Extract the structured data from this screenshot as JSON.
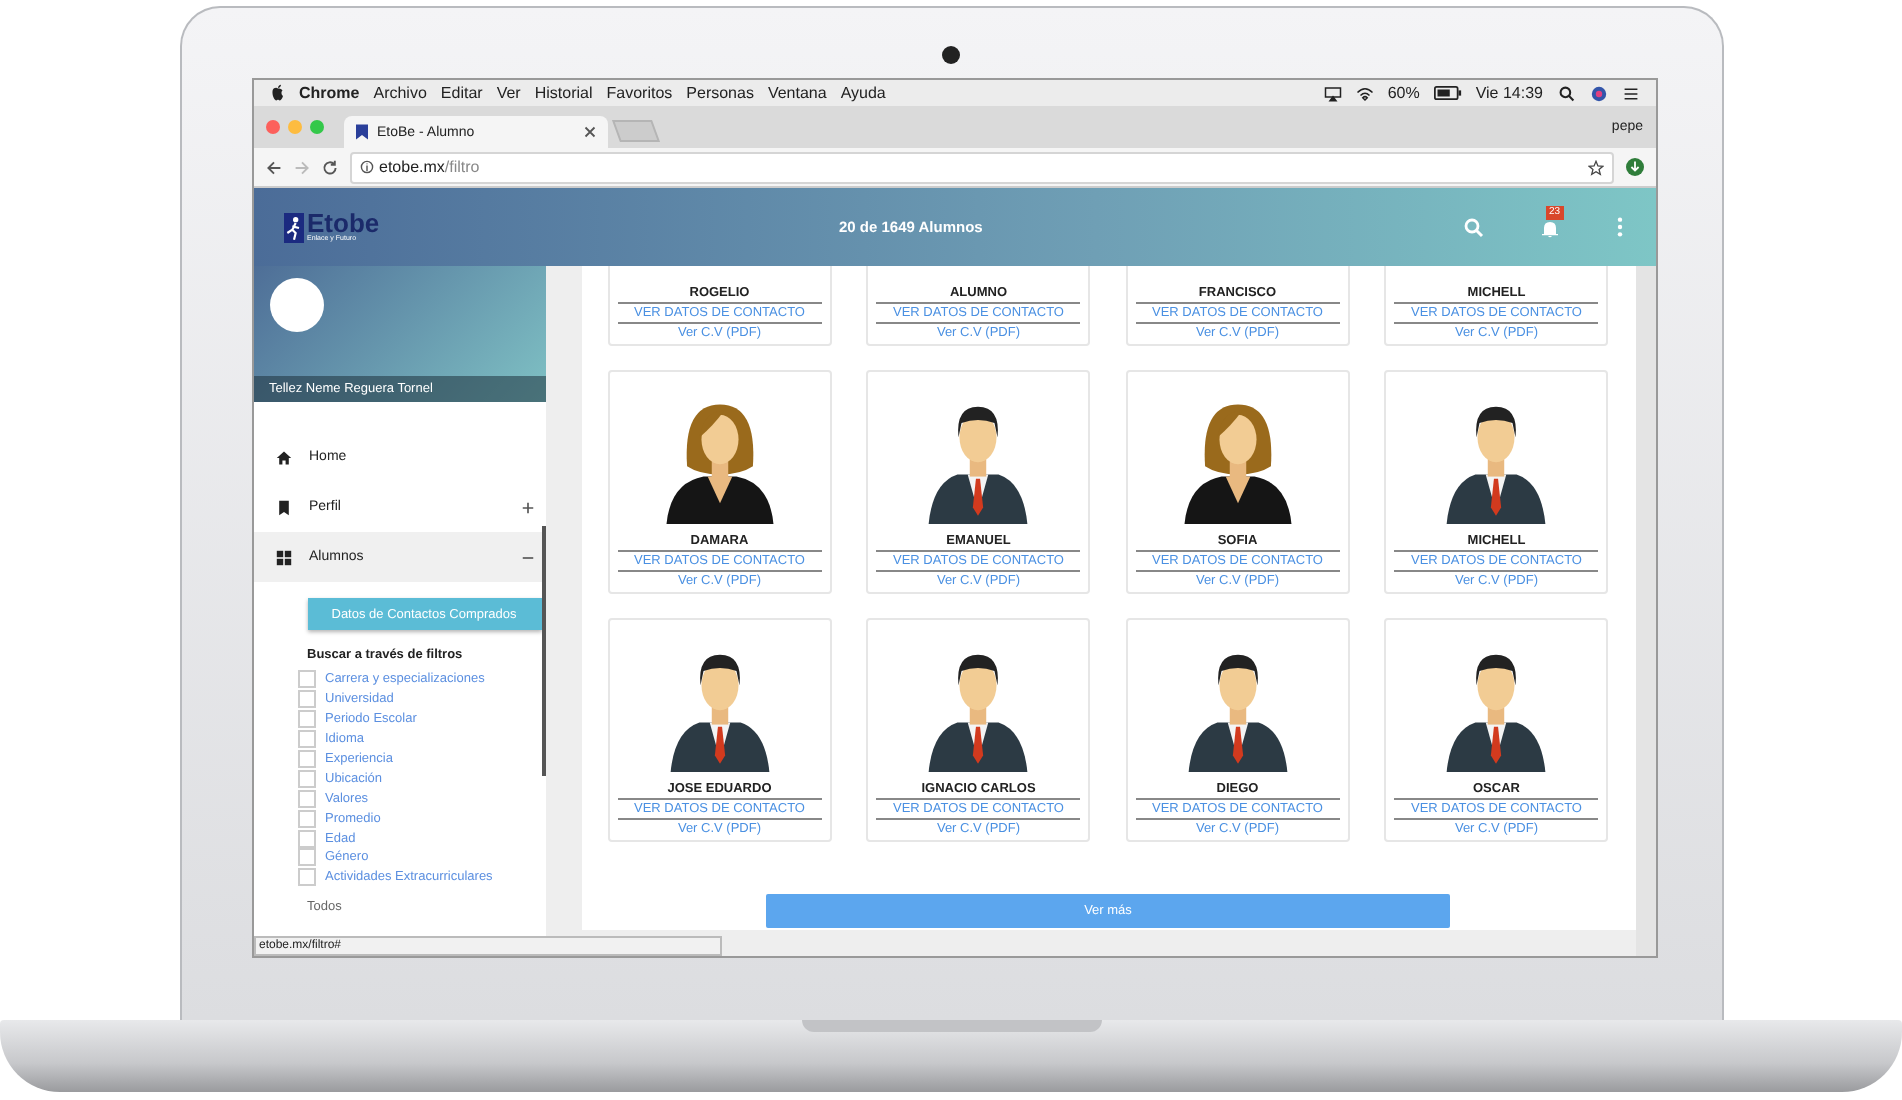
{
  "menu_bar": {
    "app": "Chrome",
    "items": [
      "Archivo",
      "Editar",
      "Ver",
      "Historial",
      "Favoritos",
      "Personas",
      "Ventana",
      "Ayuda"
    ],
    "battery": "60%",
    "clock": "Vie 14:39"
  },
  "browser": {
    "tab_title": "EtoBe - Alumno",
    "profile": "pepe",
    "url_host": "etobe.mx",
    "url_path": "/filtro",
    "status_url": "etobe.mx/filtro#"
  },
  "header": {
    "logo": "Etobe",
    "tagline": "Enlace y Futuro",
    "title": "20 de 1649 Alumnos",
    "notifications": "23"
  },
  "sidebar": {
    "user_name": "Tellez Neme Reguera Tornel",
    "items": [
      {
        "label": "Home",
        "kind": "home",
        "selected": false
      },
      {
        "label": "Perfil",
        "kind": "bookmark",
        "selected": false,
        "expanded": false
      },
      {
        "label": "Alumnos",
        "kind": "grid",
        "selected": true,
        "expanded": true
      }
    ],
    "purchased_button": "Datos de Contactos Comprados",
    "filters_heading": "Buscar a través de filtros",
    "filters": [
      {
        "label": "Carrera y especializaciones",
        "checked": false
      },
      {
        "label": "Universidad",
        "checked": false
      },
      {
        "label": "Periodo Escolar",
        "checked": false
      },
      {
        "label": "Idioma",
        "checked": false
      },
      {
        "label": "Experiencia",
        "checked": false
      },
      {
        "label": "Ubicación",
        "checked": false
      },
      {
        "label": "Valores",
        "checked": false
      },
      {
        "label": "Promedio",
        "checked": false
      },
      {
        "label": "Edad",
        "checked": false
      },
      {
        "label": "Género",
        "checked": false
      },
      {
        "label": "Actividades Extracurriculares",
        "checked": false
      }
    ],
    "all_label": "Todos"
  },
  "cards": [
    {
      "name": "ROGELIO",
      "kind": "cropped",
      "contact": "VER DATOS DE CONTACTO",
      "cv": "Ver C.V (PDF)"
    },
    {
      "name": "ALUMNO",
      "kind": "cropped",
      "contact": "VER DATOS DE CONTACTO",
      "cv": "Ver C.V (PDF)"
    },
    {
      "name": "FRANCISCO",
      "kind": "cropped",
      "contact": "VER DATOS DE CONTACTO",
      "cv": "Ver C.V (PDF)"
    },
    {
      "name": "MICHELL",
      "kind": "cropped",
      "contact": "VER DATOS DE CONTACTO",
      "cv": "Ver C.V (PDF)"
    },
    {
      "name": "DAMARA",
      "kind": "female",
      "contact": "VER DATOS DE CONTACTO",
      "cv": "Ver C.V (PDF)"
    },
    {
      "name": "EMANUEL",
      "kind": "male",
      "contact": "VER DATOS DE CONTACTO",
      "cv": "Ver C.V (PDF)"
    },
    {
      "name": "SOFIA",
      "kind": "female",
      "contact": "VER DATOS DE CONTACTO",
      "cv": "Ver C.V (PDF)"
    },
    {
      "name": "MICHELL",
      "kind": "male",
      "contact": "VER DATOS DE CONTACTO",
      "cv": "Ver C.V (PDF)"
    },
    {
      "name": "JOSE EDUARDO",
      "kind": "male",
      "contact": "VER DATOS DE CONTACTO",
      "cv": "Ver C.V (PDF)"
    },
    {
      "name": "IGNACIO CARLOS",
      "kind": "male",
      "contact": "VER DATOS DE CONTACTO",
      "cv": "Ver C.V (PDF)"
    },
    {
      "name": "DIEGO",
      "kind": "male",
      "contact": "VER DATOS DE CONTACTO",
      "cv": "Ver C.V (PDF)"
    },
    {
      "name": "OSCAR",
      "kind": "male",
      "contact": "VER DATOS DE CONTACTO",
      "cv": "Ver C.V (PDF)"
    }
  ],
  "more_button": "Ver más"
}
